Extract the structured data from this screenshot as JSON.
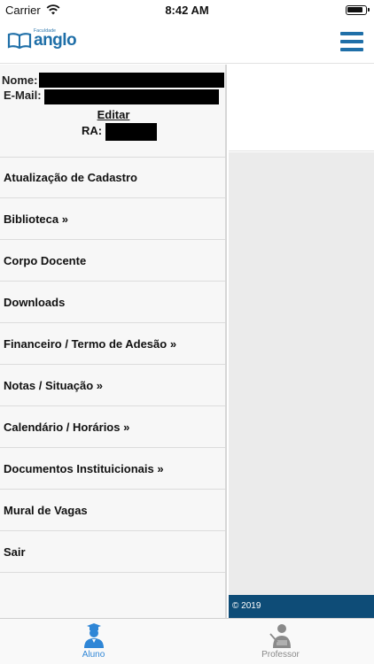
{
  "status_bar": {
    "carrier": "Carrier",
    "time": "8:42 AM"
  },
  "header": {
    "logo_small": "Faculdade",
    "logo_text": "anglo",
    "menu_icon": "hamburger-menu-icon"
  },
  "profile": {
    "nome_label": "Nome:",
    "email_label": "E-Mail:",
    "edit_label": "Editar",
    "ra_label": "RA:"
  },
  "menu": {
    "items": [
      {
        "label": "Atualização de Cadastro"
      },
      {
        "label": "Biblioteca »"
      },
      {
        "label": "Corpo Docente"
      },
      {
        "label": "Downloads"
      },
      {
        "label": "Financeiro / Termo de Adesão »"
      },
      {
        "label": "Notas / Situação »"
      },
      {
        "label": "Calendário / Horários »"
      },
      {
        "label": "Documentos Instituicionais »"
      },
      {
        "label": "Mural de Vagas"
      },
      {
        "label": "Sair"
      }
    ]
  },
  "footer": {
    "copyright": "© 2019"
  },
  "tabs": {
    "aluno": {
      "label": "Aluno",
      "icon": "student-icon"
    },
    "professor": {
      "label": "Professor",
      "icon": "teacher-icon"
    }
  },
  "colors": {
    "brand": "#1f6fa8",
    "footer": "#0e4c77",
    "tab_active": "#2f86d6",
    "tab_inactive": "#8a8a8a"
  }
}
